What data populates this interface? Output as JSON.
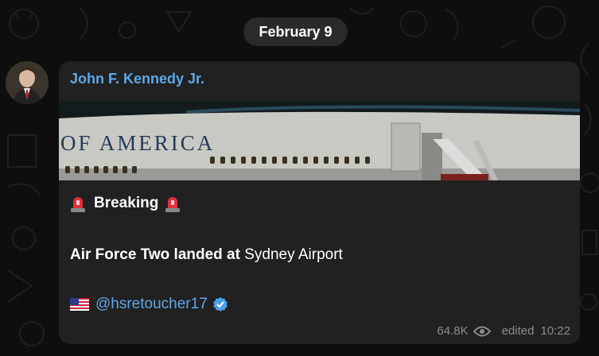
{
  "date_label": "February 9",
  "message": {
    "sender": "John F. Kennedy Jr.",
    "photo_alt": "OF AMERICA",
    "breaking_text": "Breaking",
    "body_bold": "Air Force Two landed at",
    "body_rest": " Sydney Airport",
    "handle": "@hsretoucher17",
    "views": "64.8K",
    "edited_label": "edited",
    "time": "10:22"
  },
  "icons": {
    "siren": "siren-icon",
    "flag": "us-flag-icon",
    "verified": "verified-badge-icon",
    "views": "eye-icon"
  },
  "colors": {
    "background": "#0e0e0e",
    "bubble": "#212121",
    "accent": "#5ea7e8",
    "meta": "#8c8c8c"
  }
}
